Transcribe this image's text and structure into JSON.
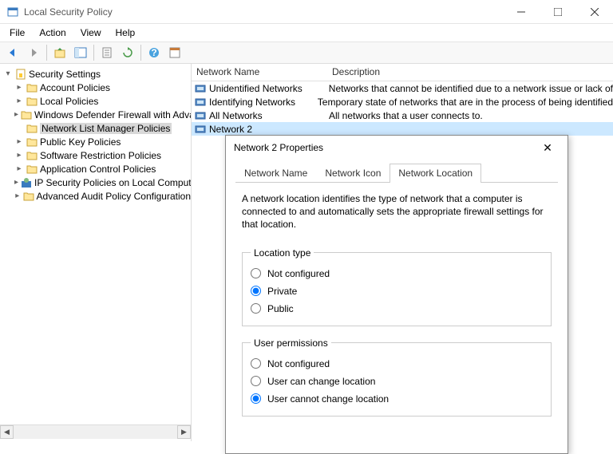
{
  "window": {
    "title": "Local Security Policy"
  },
  "menu": {
    "file": "File",
    "action": "Action",
    "view": "View",
    "help": "Help"
  },
  "tree": {
    "root": "Security Settings",
    "items": [
      "Account Policies",
      "Local Policies",
      "Windows Defender Firewall with Advanced Security",
      "Network List Manager Policies",
      "Public Key Policies",
      "Software Restriction Policies",
      "Application Control Policies",
      "IP Security Policies on Local Computer",
      "Advanced Audit Policy Configuration"
    ],
    "selected_index": 3
  },
  "list": {
    "columns": {
      "name": "Network Name",
      "desc": "Description"
    },
    "rows": [
      {
        "name": "Unidentified Networks",
        "desc": "Networks that cannot be identified due to a network issue or lack of"
      },
      {
        "name": "Identifying Networks",
        "desc": "Temporary state of networks that are in the process of being identified"
      },
      {
        "name": "All Networks",
        "desc": "All networks that a user connects to."
      },
      {
        "name": "Network 2",
        "desc": ""
      }
    ],
    "selected_index": 3
  },
  "dialog": {
    "title": "Network 2 Properties",
    "tabs": {
      "name": "Network Name",
      "icon": "Network Icon",
      "location": "Network Location"
    },
    "active_tab": "location",
    "description": "A network location identifies the type of network that a computer is connected to and automatically sets the appropriate firewall settings for that location.",
    "location_type": {
      "legend": "Location type",
      "options": {
        "not_configured": "Not configured",
        "private": "Private",
        "public": "Public"
      },
      "selected": "private"
    },
    "user_permissions": {
      "legend": "User permissions",
      "options": {
        "not_configured": "Not configured",
        "can_change": "User can change location",
        "cannot_change": "User cannot change location"
      },
      "selected": "cannot_change"
    }
  }
}
